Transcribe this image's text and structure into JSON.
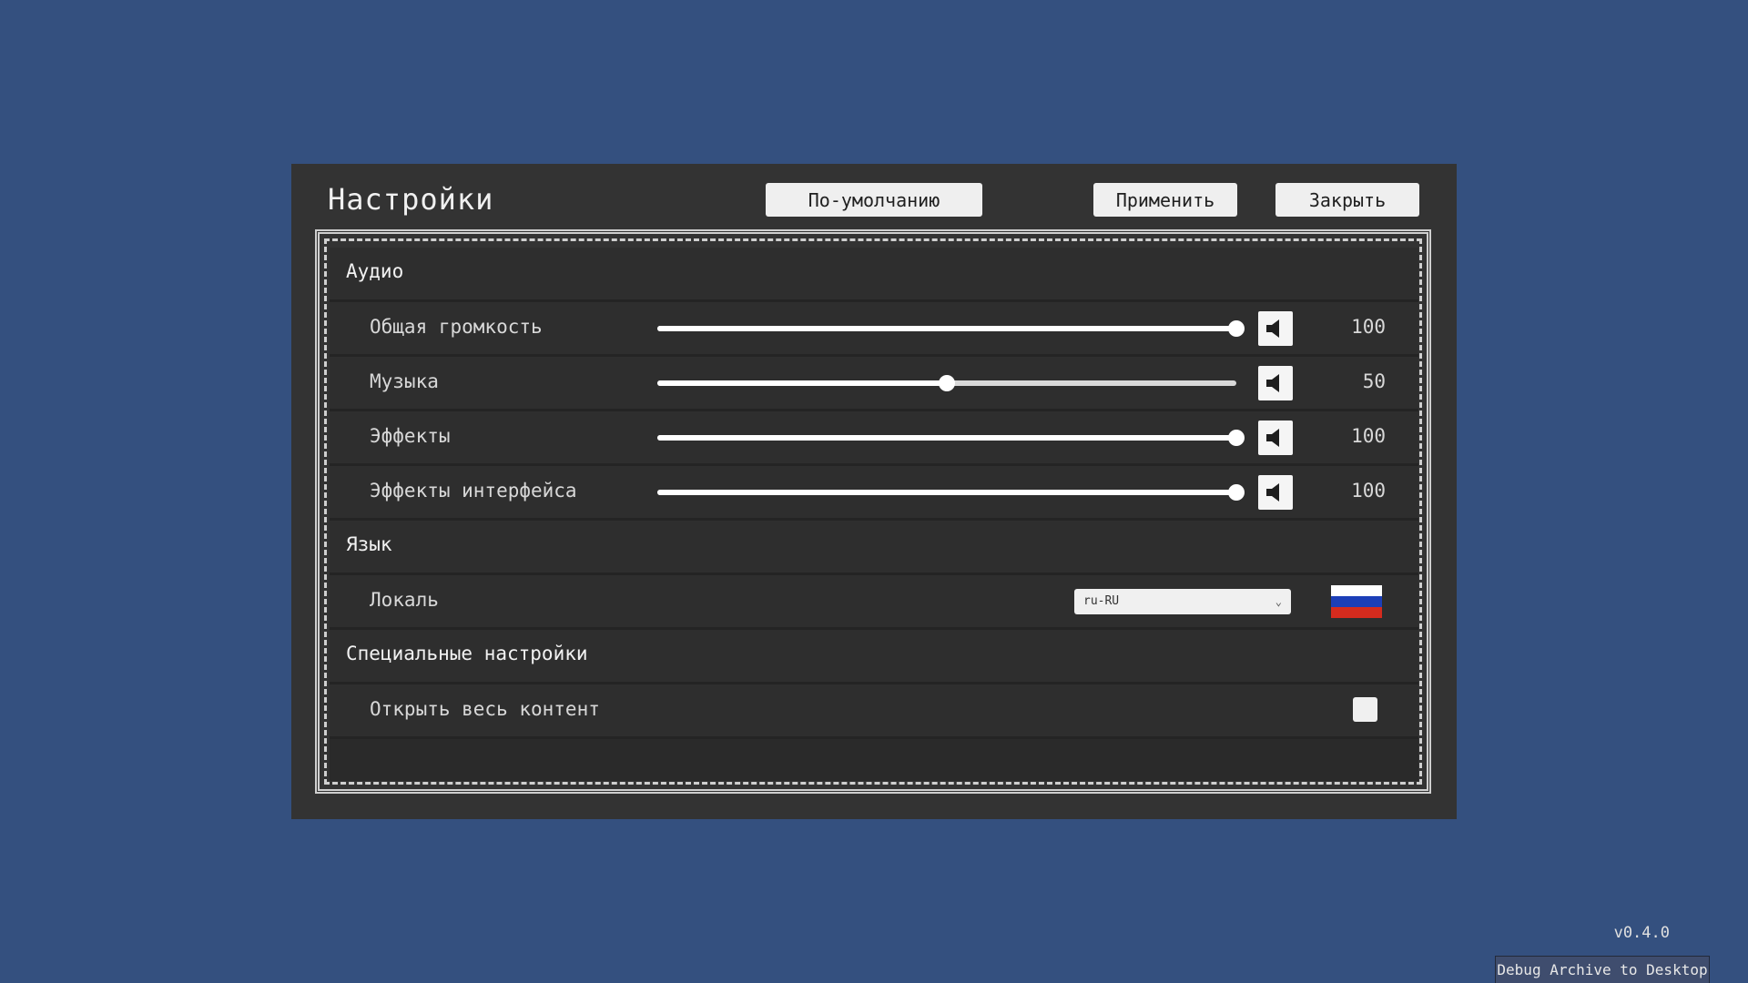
{
  "settings": {
    "title": "Настройки",
    "buttons": {
      "defaults": "По-умолчанию",
      "apply": "Применить",
      "close": "Закрыть"
    },
    "sections": {
      "audio": "Аудио",
      "language": "Язык",
      "special": "Специальные настройки"
    },
    "audio": [
      {
        "label": "Общая громкость",
        "value": "100",
        "level": 1.0
      },
      {
        "label": "Музыка",
        "value": "50",
        "level": 0.5
      },
      {
        "label": "Эффекты",
        "value": "100",
        "level": 1.0
      },
      {
        "label": "Эффекты интерфейса",
        "value": "100",
        "level": 1.0
      }
    ],
    "locale": {
      "label": "Локаль",
      "selected": "ru-RU",
      "flag_colors": [
        "#ffffff",
        "#1c3fb8",
        "#d52b1e"
      ]
    },
    "unlock": {
      "label": "Открыть весь контент",
      "checked": false
    }
  },
  "footer": {
    "version": "v0.4.0",
    "debug_button": "Debug Archive to Desktop"
  },
  "colors": {
    "background": "#34507f",
    "panel": "#333333",
    "row": "#2e2e2e"
  },
  "icons": {
    "speaker": "speaker-icon",
    "dropdown": "chevron-down-icon"
  }
}
